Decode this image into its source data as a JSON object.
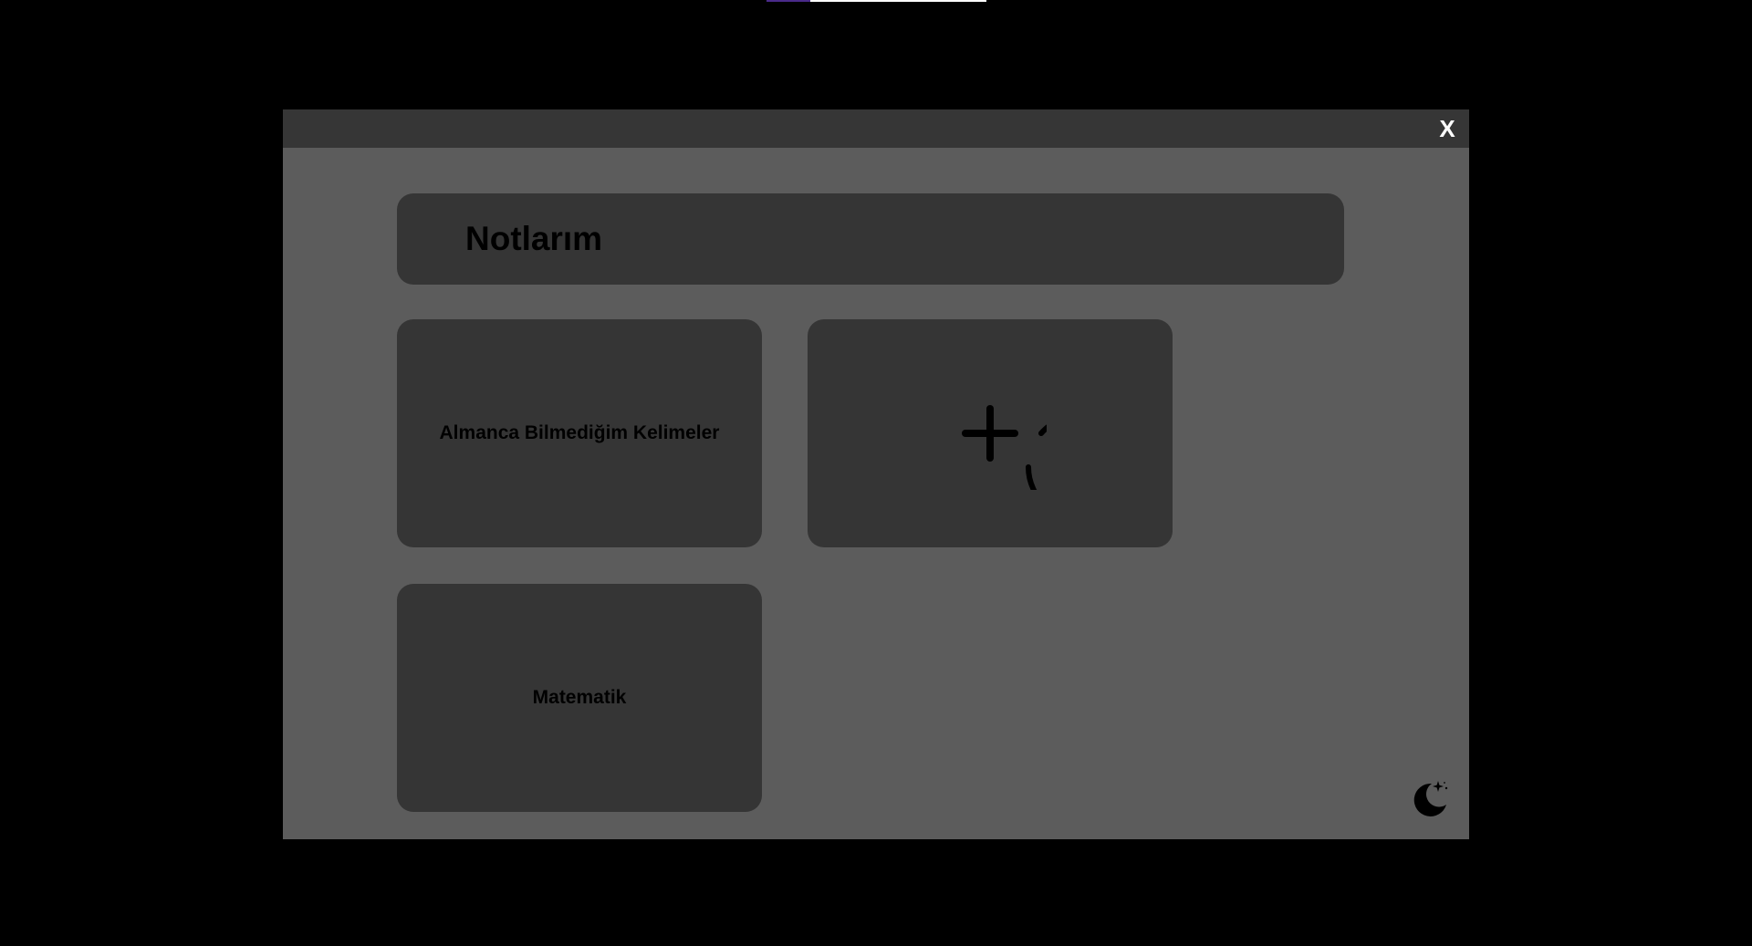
{
  "modal": {
    "close_label": "X",
    "title": "Notlarım"
  },
  "notes": [
    {
      "label": "Almanca Bilmediğim Kelimeler"
    },
    {
      "label": "Matematik"
    }
  ],
  "icons": {
    "add": "add-circle-icon",
    "theme": "moon-stars-icon",
    "close": "close-icon"
  },
  "colors": {
    "page_background": "#000000",
    "modal_background": "#5c5c5c",
    "header_background": "#363636",
    "card_background": "#353535",
    "text": "#000000",
    "close_text": "#ffffff"
  }
}
